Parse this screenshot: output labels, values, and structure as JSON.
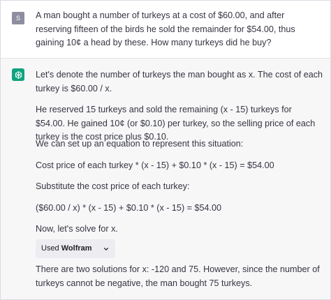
{
  "user": {
    "avatar_initial": "S",
    "message": "A man bought a number of turkeys at a cost of $60.00, and after reserving fifteen of the birds he sold the remainder for $54.00, thus gaining 10¢ a head by these. How many turkeys did he buy?"
  },
  "assistant": {
    "avatar_icon": "openai-logo-icon",
    "paragraphs": [
      "Let's denote the number of turkeys the man bought as x. The cost of each turkey is $60.00 / x.",
      "He reserved 15 turkeys and sold the remaining (x - 15) turkeys for $54.00. He gained 10¢ (or $0.10) per turkey, so the selling price of each turkey is the cost price plus $0.10.",
      "We can set up an equation to represent this situation:",
      "Cost price of each turkey * (x - 15) + $0.10 * (x - 15) = $54.00",
      "Substitute the cost price of each turkey:",
      "($60.00 / x) * (x - 15) + $0.10 * (x - 15) = $54.00",
      "Now, let's solve for x.",
      "There are two solutions for x: -120 and 75. However, since the number of turkeys cannot be negative, the man bought 75 turkeys."
    ],
    "tool_chip": {
      "prefix": "Used",
      "name": "Wolfram",
      "icon": "chevron-down-icon"
    }
  },
  "colors": {
    "assistant_bg": "#f7f7f8",
    "avatar_green": "#10a37f",
    "user_avatar": "#8e8ea0",
    "text": "#343541",
    "chip_bg": "#ececf1"
  }
}
